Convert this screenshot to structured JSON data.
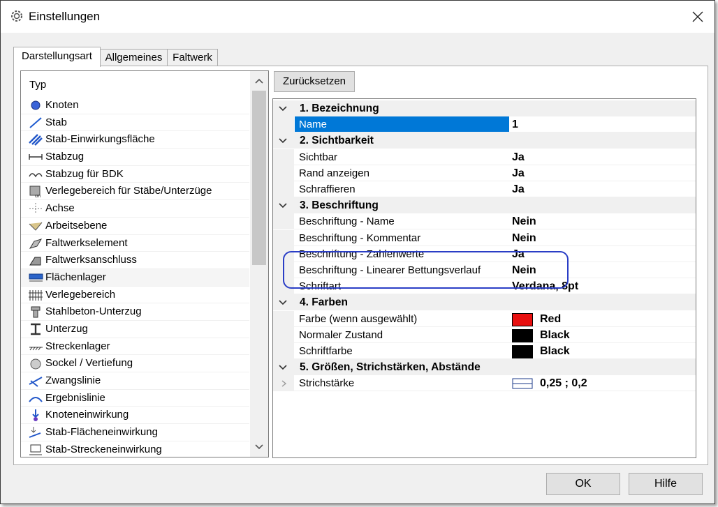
{
  "window": {
    "title": "Einstellungen"
  },
  "tabs": [
    "Darstellungsart",
    "Allgemeines",
    "Faltwerk"
  ],
  "typelist": {
    "header": "Typ",
    "items": [
      {
        "label": "Knoten",
        "icon": "node-icon"
      },
      {
        "label": "Stab",
        "icon": "bar-icon"
      },
      {
        "label": "Stab-Einwirkungsfläche",
        "icon": "bar-action-area-icon"
      },
      {
        "label": "Stabzug",
        "icon": "bar-chain-icon"
      },
      {
        "label": "Stabzug für BDK",
        "icon": "bar-chain-bdk-icon"
      },
      {
        "label": "Verlegebereich für Stäbe/Unterzüge",
        "icon": "placement-area-bars-icon"
      },
      {
        "label": "Achse",
        "icon": "axis-icon"
      },
      {
        "label": "Arbeitsebene",
        "icon": "work-plane-icon"
      },
      {
        "label": "Faltwerkselement",
        "icon": "folded-plate-element-icon"
      },
      {
        "label": "Faltwerksanschluss",
        "icon": "folded-plate-connection-icon"
      },
      {
        "label": "Flächenlager",
        "icon": "area-support-icon"
      },
      {
        "label": "Verlegebereich",
        "icon": "placement-area-icon"
      },
      {
        "label": "Stahlbeton-Unterzug",
        "icon": "rc-beam-icon"
      },
      {
        "label": "Unterzug",
        "icon": "beam-icon"
      },
      {
        "label": "Streckenlager",
        "icon": "line-support-icon"
      },
      {
        "label": "Sockel / Vertiefung",
        "icon": "pedestal-icon"
      },
      {
        "label": "Zwangslinie",
        "icon": "constraint-line-icon"
      },
      {
        "label": "Ergebnislinie",
        "icon": "result-line-icon"
      },
      {
        "label": "Knoteneinwirkung",
        "icon": "node-action-icon"
      },
      {
        "label": "Stab-Flächeneinwirkung",
        "icon": "bar-area-action-icon"
      },
      {
        "label": "Stab-Streckeneinwirkung",
        "icon": "bar-line-action-icon"
      }
    ],
    "selected_index": 10
  },
  "reset_button": "Zurücksetzen",
  "propgrid": {
    "rows": [
      {
        "kind": "cat",
        "label": "1. Bezeichnung"
      },
      {
        "kind": "prop",
        "label": "Name",
        "value": "1",
        "selected": true
      },
      {
        "kind": "cat",
        "label": "2. Sichtbarkeit"
      },
      {
        "kind": "prop",
        "label": "Sichtbar",
        "value": "Ja"
      },
      {
        "kind": "prop",
        "label": "Rand anzeigen",
        "value": "Ja"
      },
      {
        "kind": "prop",
        "label": "Schraffieren",
        "value": "Ja"
      },
      {
        "kind": "cat",
        "label": "3. Beschriftung"
      },
      {
        "kind": "prop",
        "label": "Beschriftung - Name",
        "value": "Nein"
      },
      {
        "kind": "prop",
        "label": "Beschriftung - Kommentar",
        "value": "Nein"
      },
      {
        "kind": "prop",
        "label": "Beschriftung - Zahlenwerte",
        "value": "Ja"
      },
      {
        "kind": "prop",
        "label": "Beschriftung - Linearer Bettungsverlauf",
        "value": "Nein"
      },
      {
        "kind": "prop",
        "label": "Schriftart",
        "value": "Verdana, 8pt"
      },
      {
        "kind": "cat",
        "label": "4. Farben"
      },
      {
        "kind": "color",
        "label": "Farbe (wenn ausgewählt)",
        "value": "Red",
        "swatch": "#e81010"
      },
      {
        "kind": "color",
        "label": "Normaler Zustand",
        "value": "Black",
        "swatch": "#000000"
      },
      {
        "kind": "color",
        "label": "Schriftfarbe",
        "value": "Black",
        "swatch": "#000000"
      },
      {
        "kind": "cat",
        "label": "5. Größen, Strichstärken, Abstände"
      },
      {
        "kind": "line",
        "label": "Strichstärke",
        "value": "0,25 ; 0,2"
      }
    ]
  },
  "footer": {
    "ok": "OK",
    "help": "Hilfe"
  },
  "colors": {
    "selection": "#0078d7",
    "annotation": "#2a3ec6"
  }
}
